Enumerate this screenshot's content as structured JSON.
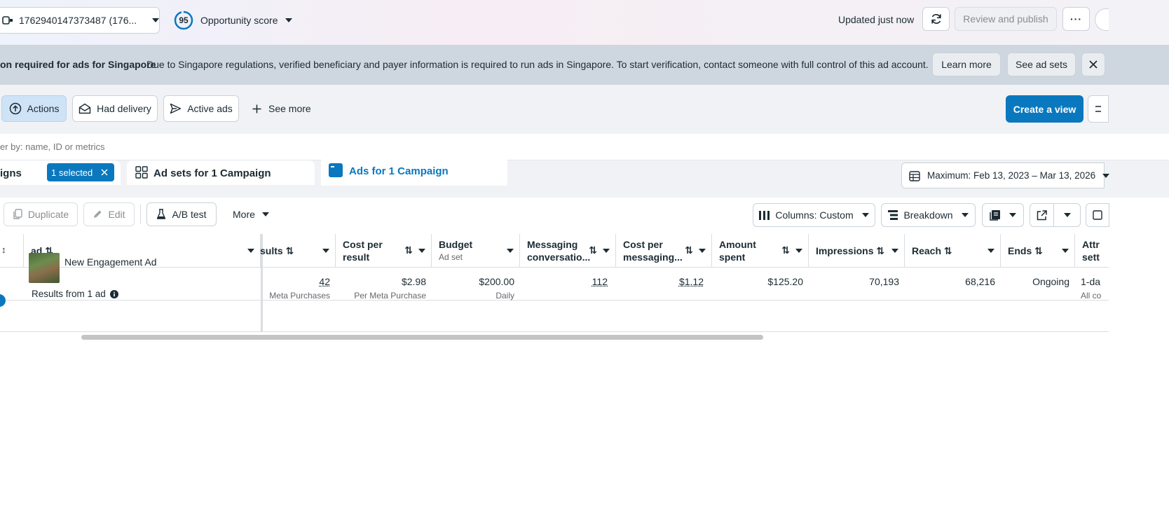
{
  "topbar": {
    "account_label": "1762940147373487 (176...",
    "score_value": "95",
    "score_label": "Opportunity score",
    "updated_text": "Updated just now",
    "review_publish_label": "Review and publish",
    "more_label": "···"
  },
  "banner": {
    "title": "on required for ads for Singapore",
    "message": "Due to Singapore regulations, verified beneficiary and payer information is required to run ads in Singapore. To start verification, contact someone with full control of this ad account.",
    "learn_more_label": "Learn more",
    "see_ad_sets_label": "See ad sets"
  },
  "filters": {
    "actions_label": "Actions",
    "had_delivery_label": "Had delivery",
    "active_ads_label": "Active ads",
    "see_more_label": "See more",
    "create_view_label": "Create a view"
  },
  "search": {
    "placeholder": "er by: name, ID or metrics"
  },
  "tabs": {
    "campaigns_label": "igns",
    "selected_badge": "1 selected",
    "ad_sets_label": "Ad sets for 1 Campaign",
    "ads_label": "Ads for 1 Campaign",
    "date_range": "Maximum: Feb 13, 2023 – Mar 13, 2026"
  },
  "toolbar": {
    "duplicate_label": "Duplicate",
    "edit_label": "Edit",
    "ab_test_label": "A/B test",
    "more_label": "More",
    "columns_label": "Columns: Custom",
    "breakdown_label": "Breakdown"
  },
  "table": {
    "headers": {
      "ad": "ad",
      "results": "sults",
      "cost_per_result": "Cost per result",
      "budget": "Budget",
      "budget_sub": "Ad set",
      "messaging": "Messaging conversatio...",
      "cost_per_messaging": "Cost per messaging...",
      "amount_spent": "Amount spent",
      "impressions": "Impressions",
      "reach": "Reach",
      "ends": "Ends",
      "attribution": "Attr sett"
    },
    "row": {
      "ad_name": "New Engagement Ad",
      "results": "42",
      "results_sub": "Meta Purchases",
      "cost_per_result": "$2.98",
      "cost_per_result_sub": "Per Meta Purchase",
      "budget": "$200.00",
      "budget_sub": "Daily",
      "messaging": "112",
      "cost_per_messaging": "$1.12",
      "amount_spent": "$125.20",
      "impressions": "70,193",
      "reach": "68,216",
      "ends": "Ongoing",
      "attribution": "1-da",
      "attribution_sub": "All co"
    },
    "footer": "Results from 1 ad"
  },
  "colors": {
    "primary": "#0a78be",
    "banner_bg": "#ced6df",
    "selected_chip": "#cfe3f6"
  }
}
